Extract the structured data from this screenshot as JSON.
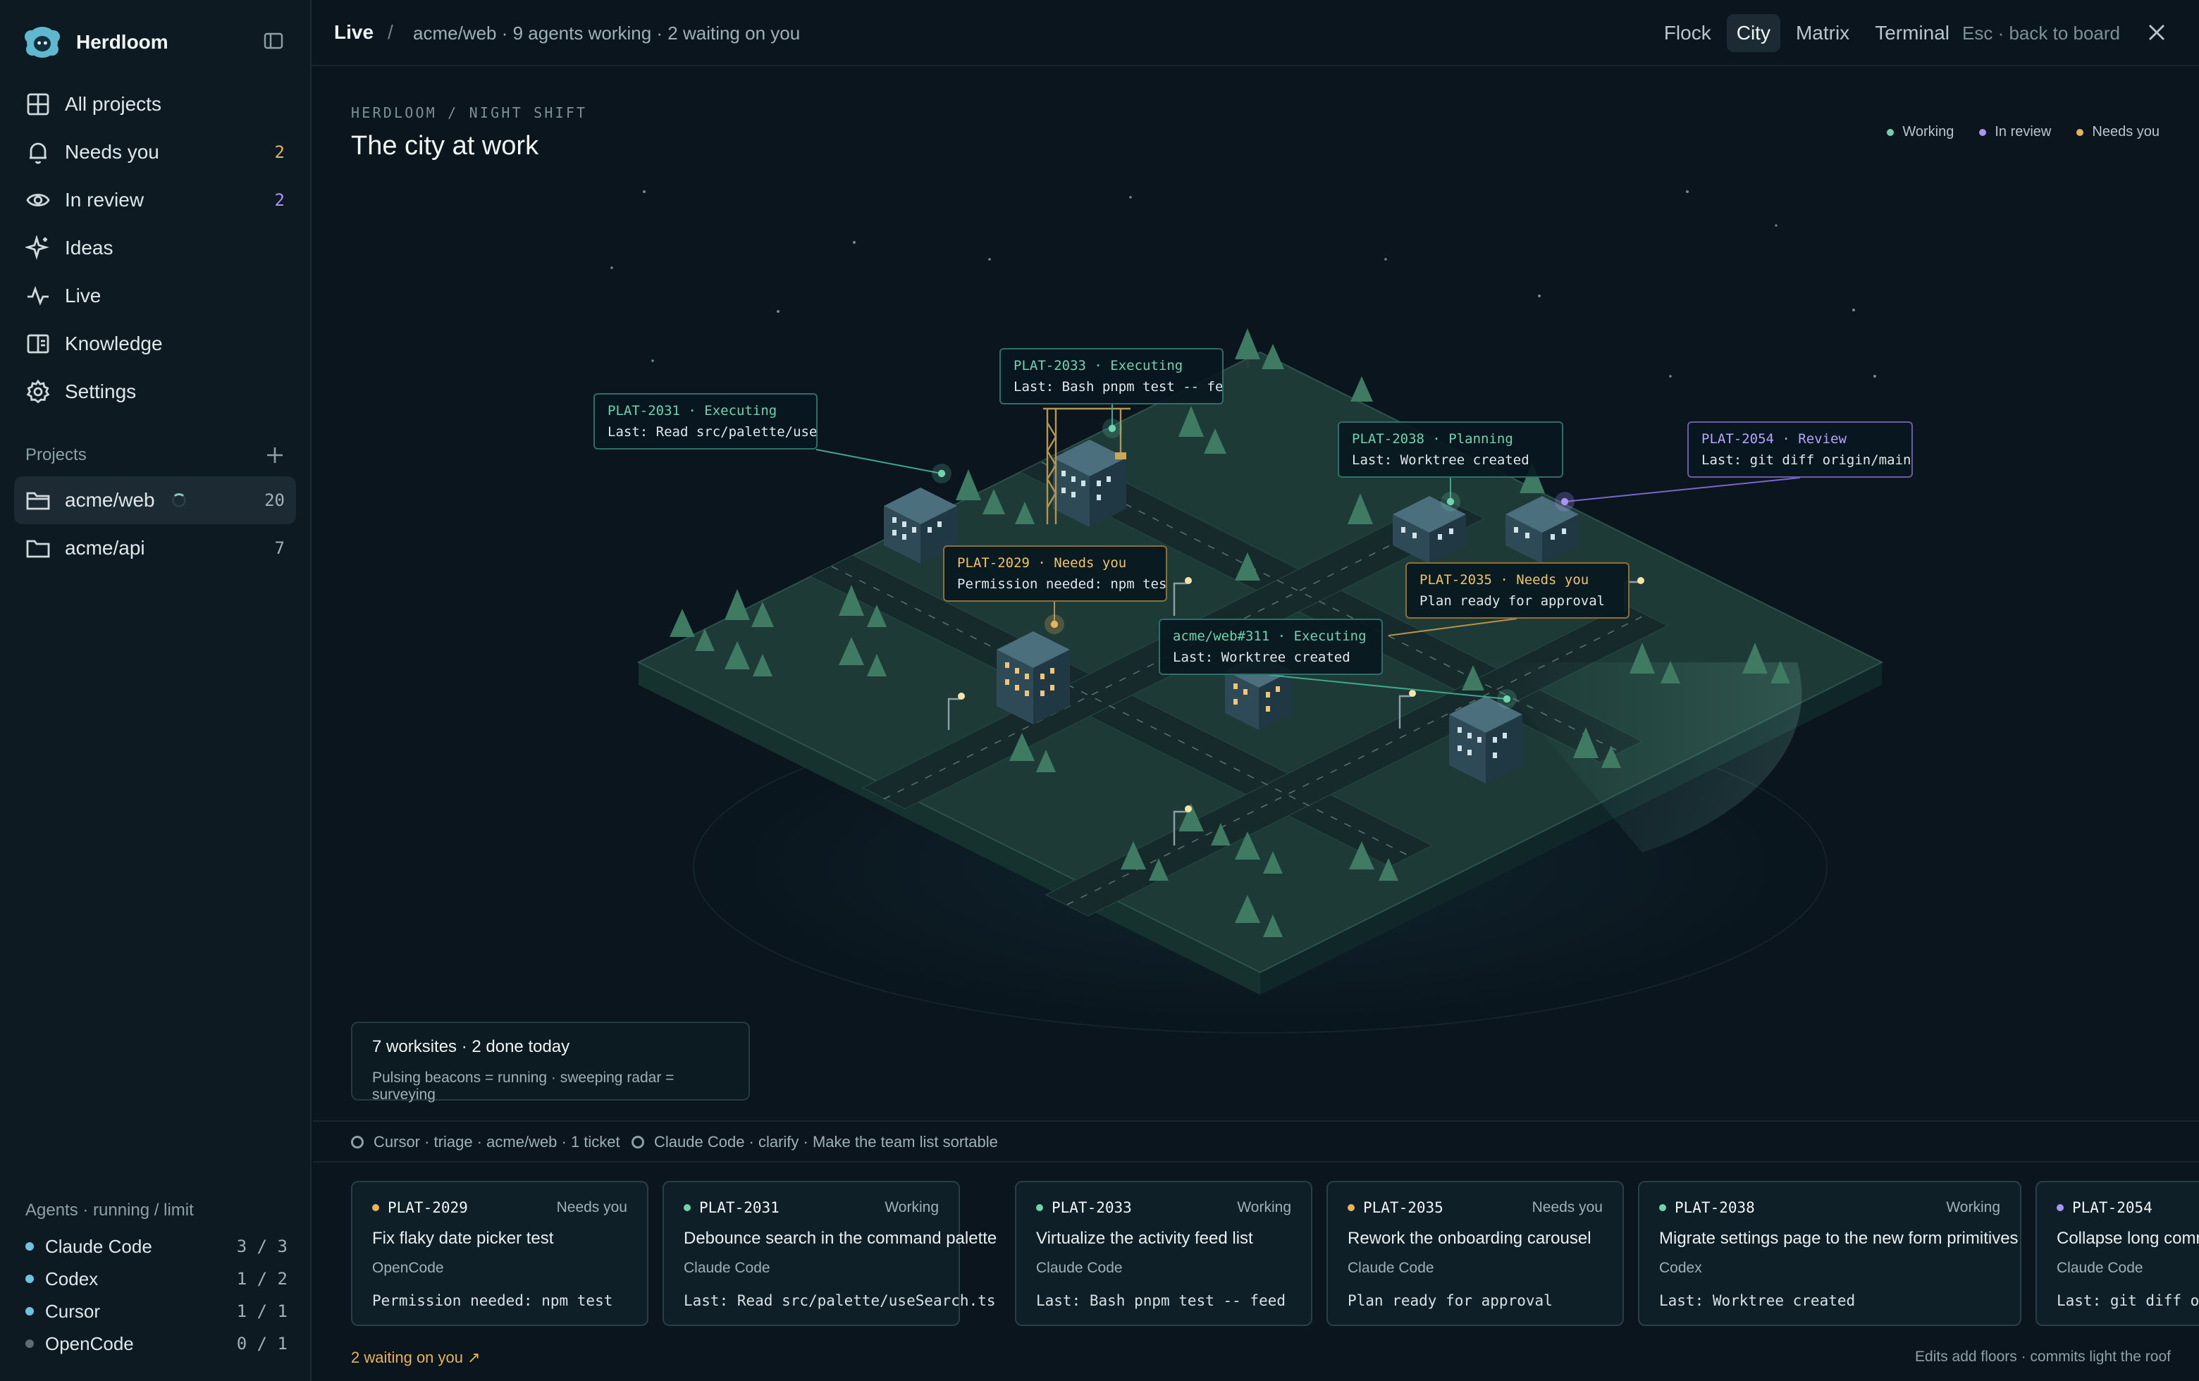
{
  "app": {
    "name": "Herdloom"
  },
  "sidebar": {
    "nav": [
      {
        "label": "All projects",
        "icon": "grid-icon",
        "count": ""
      },
      {
        "label": "Needs you",
        "icon": "bell-icon",
        "count": "2"
      },
      {
        "label": "In review",
        "icon": "eye-icon",
        "count": "2"
      },
      {
        "label": "Ideas",
        "icon": "sparkle-icon",
        "count": ""
      },
      {
        "label": "Live",
        "icon": "pulse-icon",
        "count": ""
      },
      {
        "label": "Knowledge",
        "icon": "book-icon",
        "count": ""
      },
      {
        "label": "Settings",
        "icon": "gear-icon",
        "count": ""
      }
    ],
    "projects_label": "Projects",
    "projects": [
      {
        "name": "acme/web",
        "count": "20",
        "active": true
      },
      {
        "name": "acme/api",
        "count": "7",
        "active": false
      }
    ],
    "agents_label": "Agents · running / limit",
    "agents": [
      {
        "name": "Claude Code",
        "usage": "3 / 3",
        "color": "#6fc2e0"
      },
      {
        "name": "Codex",
        "usage": "1 / 2",
        "color": "#6fc2e0"
      },
      {
        "name": "Cursor",
        "usage": "1 / 1",
        "color": "#6fc2e0"
      },
      {
        "name": "OpenCode",
        "usage": "0 / 1",
        "color": "#5e6b71"
      }
    ]
  },
  "topbar": {
    "crumb": "Live",
    "separator": "/",
    "description": "acme/web · 9 agents working · 2 waiting on you",
    "tabs": [
      "Flock",
      "City",
      "Matrix",
      "Terminal"
    ],
    "active_tab": "City",
    "esc_hint": "Esc · back to board"
  },
  "main": {
    "eyebrow": "HERDLOOM / NIGHT SHIFT",
    "title": "The city at work",
    "legend": [
      {
        "label": "Working",
        "color": "#6fd3ae"
      },
      {
        "label": "In review",
        "color": "#a994f2"
      },
      {
        "label": "Needs you",
        "color": "#e7b35a"
      }
    ],
    "tags": [
      {
        "head": "PLAT-2031 · Executing",
        "body": "Last: Read src/palette/use…",
        "tone": "green"
      },
      {
        "head": "PLAT-2033 · Executing",
        "body": "Last: Bash pnpm test -- fe…",
        "tone": "green"
      },
      {
        "head": "PLAT-2038 · Planning",
        "body": "Last: Worktree created",
        "tone": "green"
      },
      {
        "head": "PLAT-2054 · Review",
        "body": "Last: git diff origin/main…",
        "tone": "violet"
      },
      {
        "head": "PLAT-2029 · Needs you",
        "body": "Permission needed: npm test",
        "tone": "amber"
      },
      {
        "head": "PLAT-2035 · Needs you",
        "body": "Plan ready for approval",
        "tone": "amber"
      },
      {
        "head": "acme/web#311 · Executing",
        "body": "Last: Worktree created",
        "tone": "green"
      }
    ],
    "summary": {
      "line1": "7 worksites · 2 done today",
      "line2": "Pulsing beacons = running · sweeping radar = surveying"
    },
    "activity": [
      "Cursor · triage · acme/web · 1 ticket",
      "Claude Code · clarify · Make the team list sortable"
    ],
    "cards": [
      {
        "id": "PLAT-2029",
        "status": "Needs you",
        "title": "Fix flaky date picker test",
        "agent": "OpenCode",
        "last": "Permission needed: npm test",
        "color": "#e7b35a"
      },
      {
        "id": "PLAT-2031",
        "status": "Working",
        "title": "Debounce search in the command palette",
        "agent": "Claude Code",
        "last": "Last: Read src/palette/useSearch.ts",
        "color": "#6fd3ae"
      },
      {
        "id": "PLAT-2033",
        "status": "Working",
        "title": "Virtualize the activity feed list",
        "agent": "Claude Code",
        "last": "Last: Bash pnpm test -- feed",
        "color": "#6fd3ae"
      },
      {
        "id": "PLAT-2035",
        "status": "Needs you",
        "title": "Rework the onboarding carousel",
        "agent": "Claude Code",
        "last": "Plan ready for approval",
        "color": "#e7b35a"
      },
      {
        "id": "PLAT-2038",
        "status": "Working",
        "title": "Migrate settings page to the new form primitives",
        "agent": "Codex",
        "last": "Last: Worktree created",
        "color": "#6fd3ae"
      },
      {
        "id": "PLAT-2054",
        "status": "",
        "title": "Collapse long comme",
        "agent": "Claude Code",
        "last": "Last: git diff ori",
        "color": "#a994f2"
      }
    ],
    "waiting_link": "2 waiting on you ↗",
    "footer_hint": "Edits add floors · commits light the roof"
  }
}
